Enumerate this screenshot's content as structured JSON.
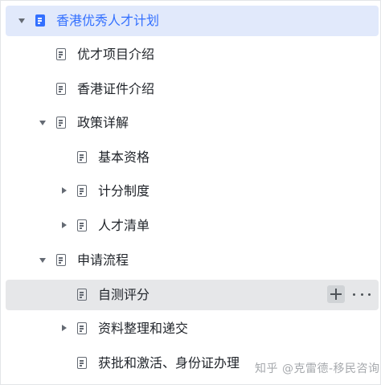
{
  "tree": {
    "root": {
      "label": "香港优秀人才计划",
      "expanded": true,
      "selected": true
    },
    "items": [
      {
        "label": "优才项目介绍"
      },
      {
        "label": "香港证件介绍"
      },
      {
        "label": "政策详解",
        "expanded": true
      },
      {
        "label": "基本资格"
      },
      {
        "label": "计分制度",
        "collapsed": true
      },
      {
        "label": "人才清单",
        "collapsed": true
      },
      {
        "label": "申请流程",
        "expanded": true
      },
      {
        "label": "自测评分",
        "hovered": true
      },
      {
        "label": "资料整理和递交",
        "collapsed": true
      },
      {
        "label": "获批和激活、身份证办理"
      }
    ]
  },
  "icons": {
    "expand": "caret-down-icon",
    "collapsed": "caret-right-icon",
    "document": "document-icon",
    "add": "plus-icon",
    "more": "more-icon"
  },
  "colors": {
    "accent": "#3370ff",
    "selected_bg": "#e1e9fb",
    "hover_bg": "#e6e7e9"
  },
  "watermark": "知乎 @克雷德-移民咨询"
}
